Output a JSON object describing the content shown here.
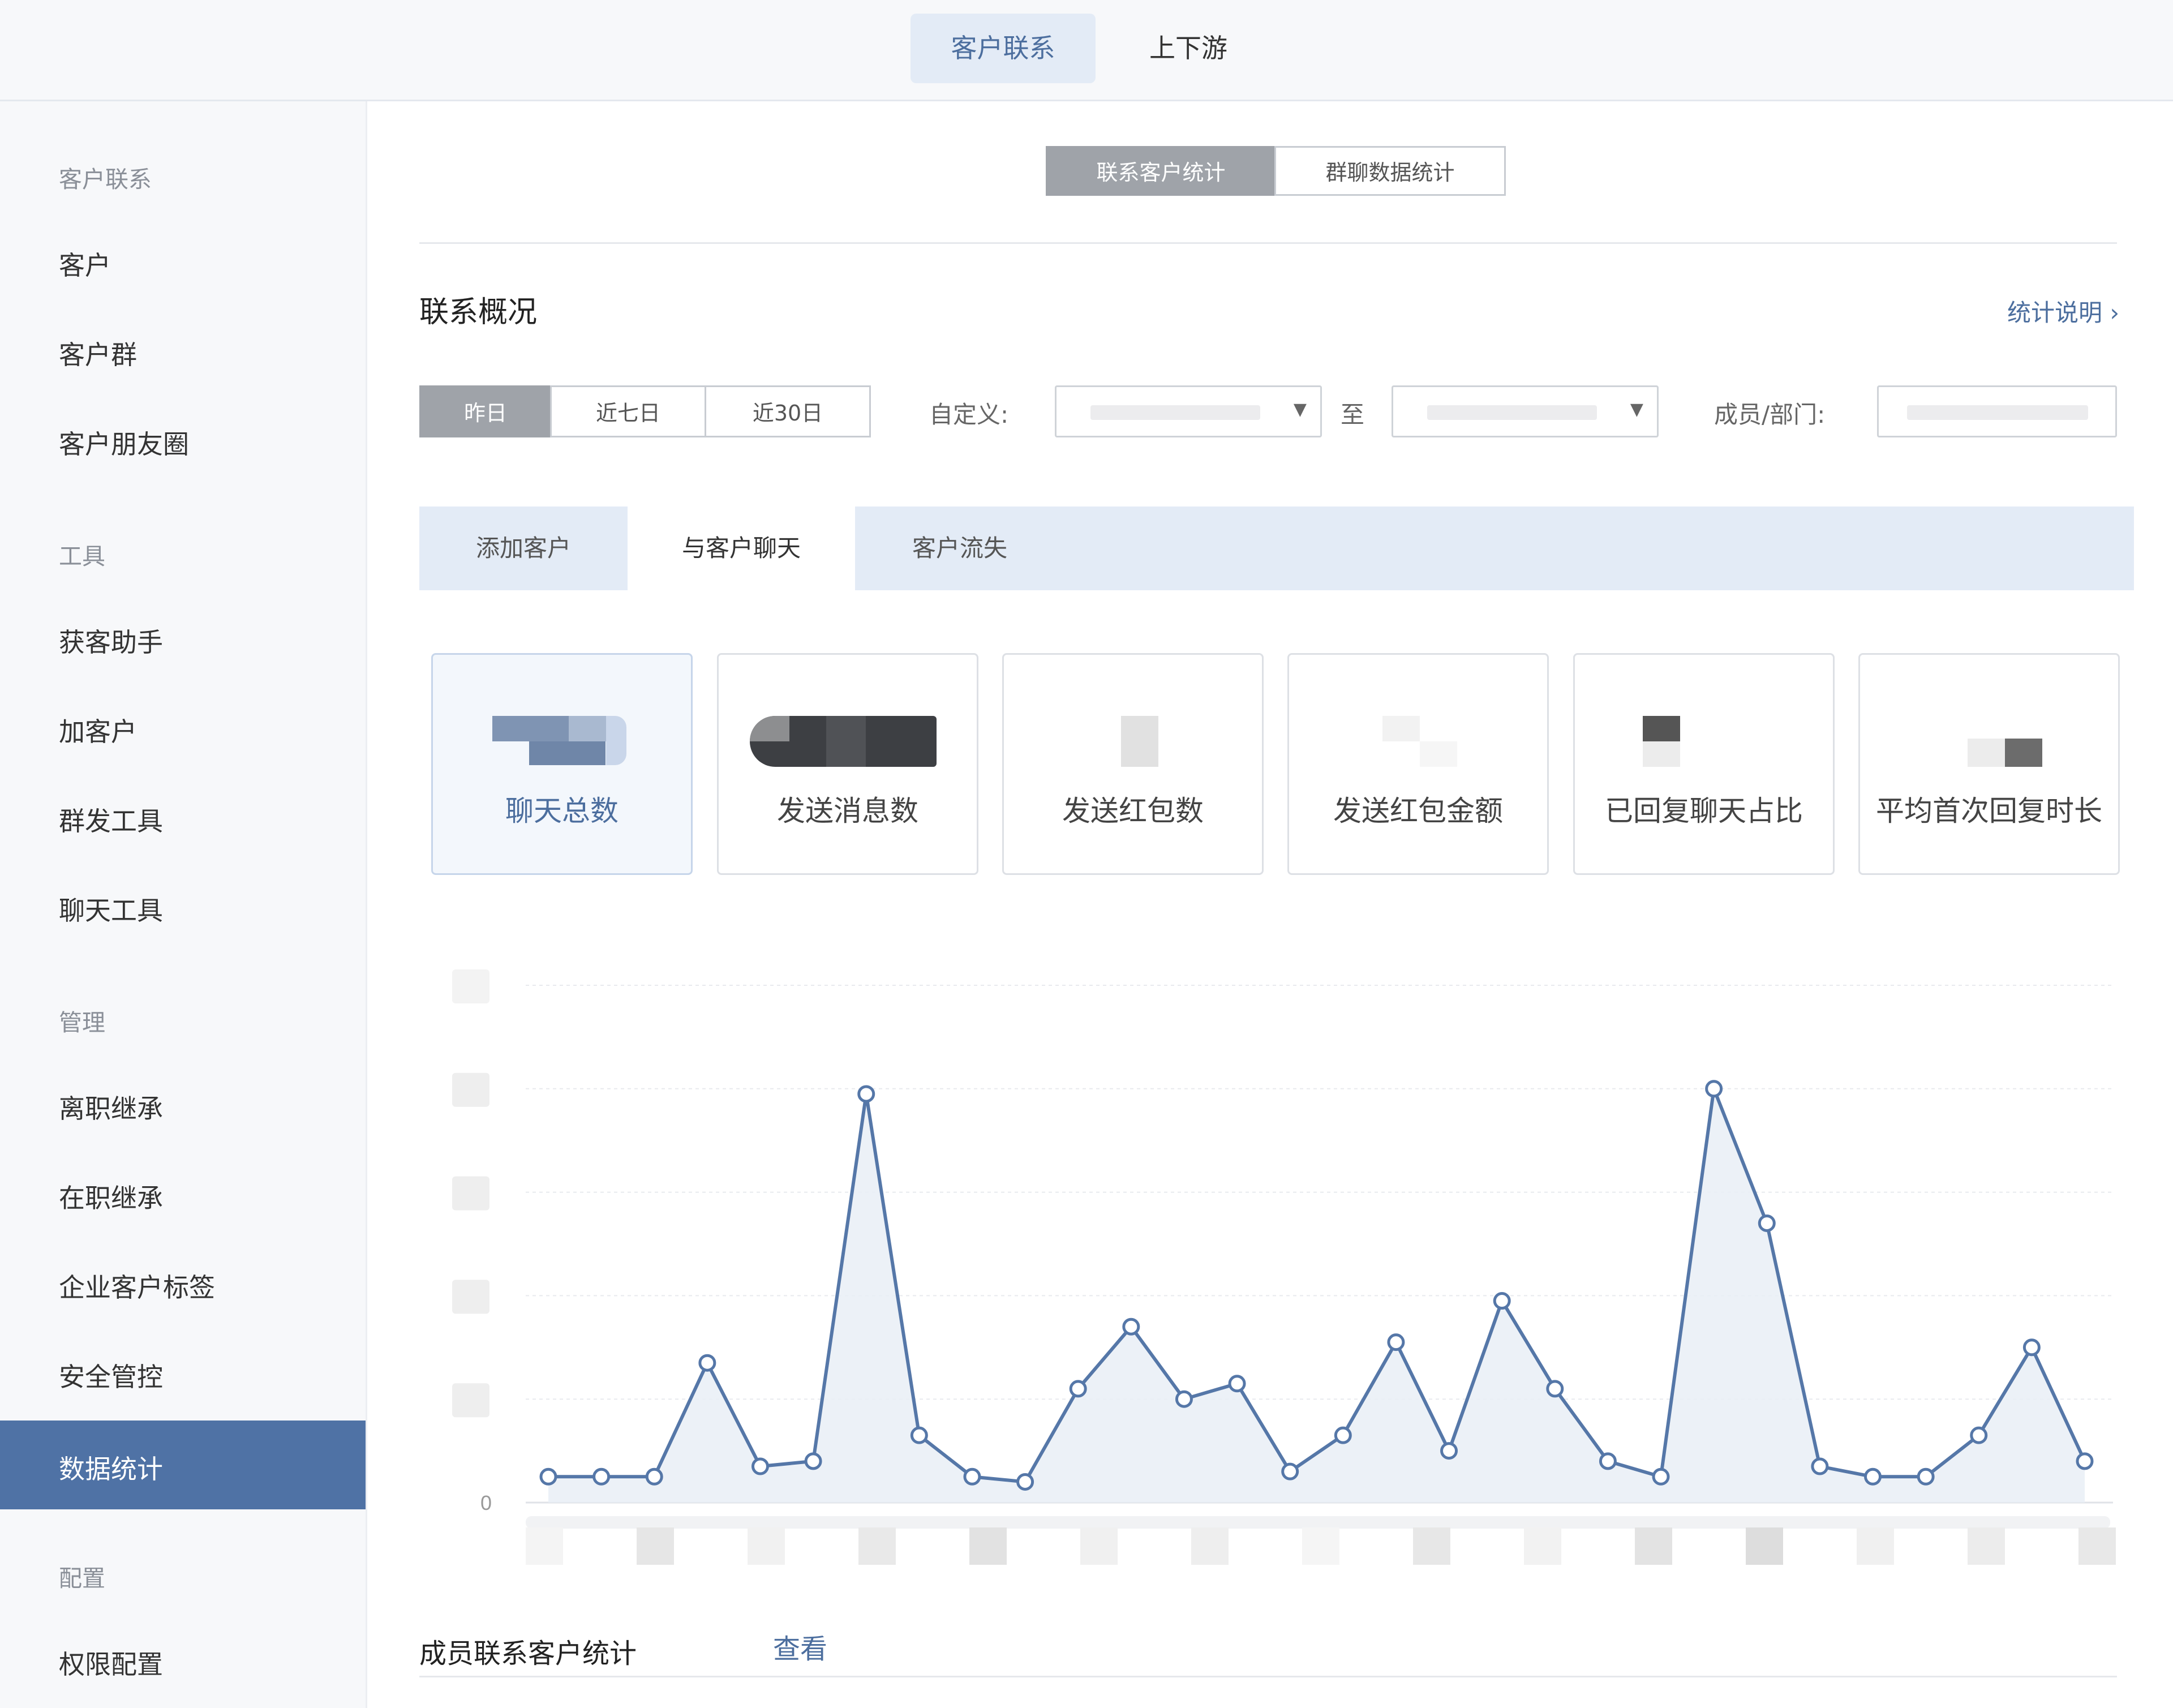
{
  "top_tabs": [
    {
      "label": "客户联系",
      "active": true
    },
    {
      "label": "上下游",
      "active": false
    }
  ],
  "sidebar": {
    "groups": [
      {
        "title": "客户联系",
        "items": [
          "客户",
          "客户群",
          "客户朋友圈"
        ]
      },
      {
        "title": "工具",
        "items": [
          "获客助手",
          "加客户",
          "群发工具",
          "聊天工具"
        ]
      },
      {
        "title": "管理",
        "items": [
          "离职继承",
          "在职继承",
          "企业客户标签",
          "安全管控",
          "数据统计"
        ]
      },
      {
        "title": "配置",
        "items": [
          "权限配置"
        ]
      }
    ],
    "active_item": "数据统计"
  },
  "stat_tabs": [
    {
      "label": "联系客户统计",
      "active": true
    },
    {
      "label": "群聊数据统计",
      "active": false
    }
  ],
  "overview": {
    "title": "联系概况",
    "help_link": "统计说明 ›"
  },
  "filters": {
    "range_buttons": [
      {
        "label": "昨日",
        "active": true
      },
      {
        "label": "近七日",
        "active": false
      },
      {
        "label": "近30日",
        "active": false
      }
    ],
    "custom_label": "自定义:",
    "to_label": "至",
    "member_label": "成员/部门:"
  },
  "subtabs": [
    {
      "label": "添加客户",
      "active": false
    },
    {
      "label": "与客户聊天",
      "active": true
    },
    {
      "label": "客户流失",
      "active": false
    }
  ],
  "metrics": [
    {
      "label": "聊天总数",
      "active": true
    },
    {
      "label": "发送消息数",
      "active": false
    },
    {
      "label": "发送红包数",
      "active": false
    },
    {
      "label": "发送红包金额",
      "active": false
    },
    {
      "label": "已回复聊天占比",
      "active": false
    },
    {
      "label": "平均首次回复时长",
      "active": false
    }
  ],
  "chart_data": {
    "type": "area",
    "y_zero_label": "0",
    "series": [
      {
        "values": [
          5,
          5,
          5,
          27,
          7,
          8,
          79,
          13,
          5,
          4,
          22,
          34,
          20,
          23,
          6,
          13,
          31,
          10,
          39,
          22,
          8,
          5,
          80,
          54,
          7,
          5,
          5,
          13,
          30,
          8
        ]
      }
    ],
    "ylim": [
      0,
      100
    ],
    "grid": true,
    "color": "#5577a8"
  },
  "footer": {
    "title": "成员联系客户统计",
    "link": "查看"
  }
}
